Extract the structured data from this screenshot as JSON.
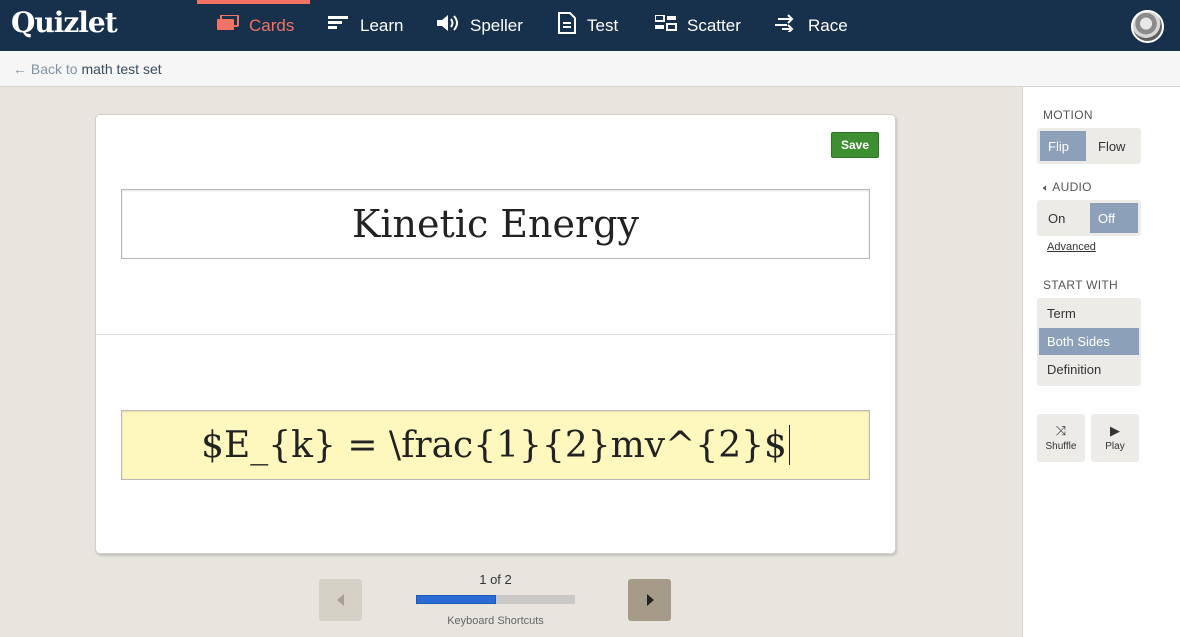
{
  "app": {
    "logo": "Quizlet"
  },
  "nav": {
    "items": [
      {
        "label": "Cards",
        "icon": "cards-icon",
        "active": true
      },
      {
        "label": "Learn",
        "icon": "learn-icon"
      },
      {
        "label": "Speller",
        "icon": "speaker-icon"
      },
      {
        "label": "Test",
        "icon": "document-icon"
      },
      {
        "label": "Scatter",
        "icon": "scatter-icon"
      },
      {
        "label": "Race",
        "icon": "race-icon"
      }
    ],
    "active_color": "#f17364"
  },
  "subbar": {
    "back_prefix": "← Back to",
    "set_name": "math test set"
  },
  "card": {
    "save_label": "Save",
    "term": "Kinetic Energy",
    "definition": "$E_{k} = \\frac{1}{2}mv^{2}$"
  },
  "pager": {
    "count": "1 of 2",
    "progress": 0.5,
    "shortcuts": "Keyboard Shortcuts"
  },
  "panel": {
    "motion": {
      "title": "MOTION",
      "options": [
        "Flip",
        "Flow"
      ],
      "selected": "Flip"
    },
    "audio": {
      "title": "AUDIO",
      "options": [
        "On",
        "Off"
      ],
      "selected": "Off",
      "advanced": "Advanced"
    },
    "start_with": {
      "title": "START WITH",
      "options": [
        "Term",
        "Both Sides",
        "Definition"
      ],
      "selected": "Both Sides"
    },
    "shuffle_label": "Shuffle",
    "play_label": "Play"
  }
}
